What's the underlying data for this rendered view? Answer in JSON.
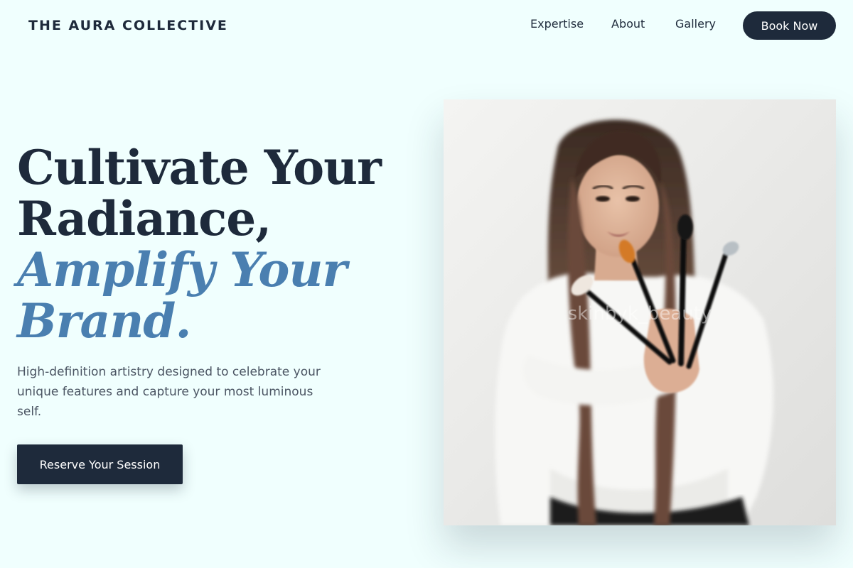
{
  "header": {
    "brand": "THE AURA COLLECTIVE",
    "nav": [
      {
        "label": "Expertise"
      },
      {
        "label": "About"
      },
      {
        "label": "Gallery"
      }
    ],
    "cta_label": "Book Now"
  },
  "hero": {
    "title_line1": "Cultivate Your",
    "title_line2": "Radiance,",
    "title_accent1": "Amplify Your",
    "title_accent2": "Brand.",
    "subtitle": "High-definition artistry designed to celebrate your unique features and capture your most luminous self.",
    "cta_label": "Reserve Your Session"
  },
  "photo": {
    "subject": "makeup artist holding brushes",
    "watermark": "skinbyk_beauty"
  },
  "colors": {
    "background": "#f0fffe",
    "navy": "#1e2a3b",
    "accent_blue": "#4a7fb0",
    "body_text": "#4b5563"
  }
}
